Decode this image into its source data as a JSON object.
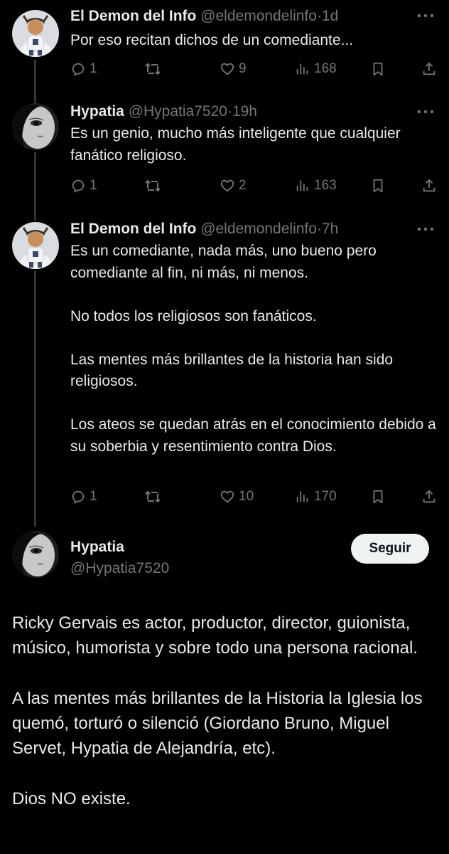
{
  "replies": [
    {
      "name": "El Demon del Info",
      "handle": "@eldemondelinfo",
      "separator": "·",
      "time": "1d",
      "paragraphs": [
        "Por eso recitan dichos de un comediante..."
      ],
      "stats": {
        "replies": "1",
        "reposts": "",
        "likes": "9",
        "views": "168"
      },
      "avatar_icon": "cartoon-baseball-player-avatar"
    },
    {
      "name": "Hypatia",
      "handle": "@Hypatia7520",
      "separator": "·",
      "time": "19h",
      "paragraphs": [
        "Es un genio, mucho más inteligente que cualquier fanático religioso."
      ],
      "stats": {
        "replies": "1",
        "reposts": "",
        "likes": "2",
        "views": "163"
      },
      "avatar_icon": "grayscale-face-avatar"
    },
    {
      "name": "El Demon del Info",
      "handle": "@eldemondelinfo",
      "separator": "·",
      "time": "7h",
      "paragraphs": [
        "Es un comediante, nada más, uno bueno pero comediante al fin, ni más, ni menos.",
        "No todos los religiosos son fanáticos.",
        "Las mentes más brillantes de la historia han sido religiosos.",
        "Los ateos se quedan atrás en el conocimiento debido a su soberbia y resentimiento contra Dios."
      ],
      "stats": {
        "replies": "1",
        "reposts": "",
        "likes": "10",
        "views": "170"
      },
      "avatar_icon": "cartoon-baseball-player-avatar"
    }
  ],
  "main_post": {
    "name": "Hypatia",
    "handle": "@Hypatia7520",
    "follow_label": "Seguir",
    "paragraphs": [
      "Ricky Gervais es actor, productor, director, guionista, músico, humorista y sobre todo una persona racional.",
      "A las mentes más brillantes de la Historia la Iglesia los quemó, torturó o silenció (Giordano Bruno, Miguel Servet, Hypatia de Alejandría, etc).",
      "Dios NO existe."
    ],
    "avatar_icon": "grayscale-face-avatar"
  },
  "colors": {
    "background": "#000000",
    "primary_text": "#e7e9ea",
    "secondary_text": "#71767b",
    "thread_line": "#333639",
    "follow_button_bg": "#eff3f4"
  },
  "icons": [
    "reply-icon",
    "repost-icon",
    "like-icon",
    "views-icon",
    "bookmark-icon",
    "share-icon",
    "more-icon"
  ]
}
